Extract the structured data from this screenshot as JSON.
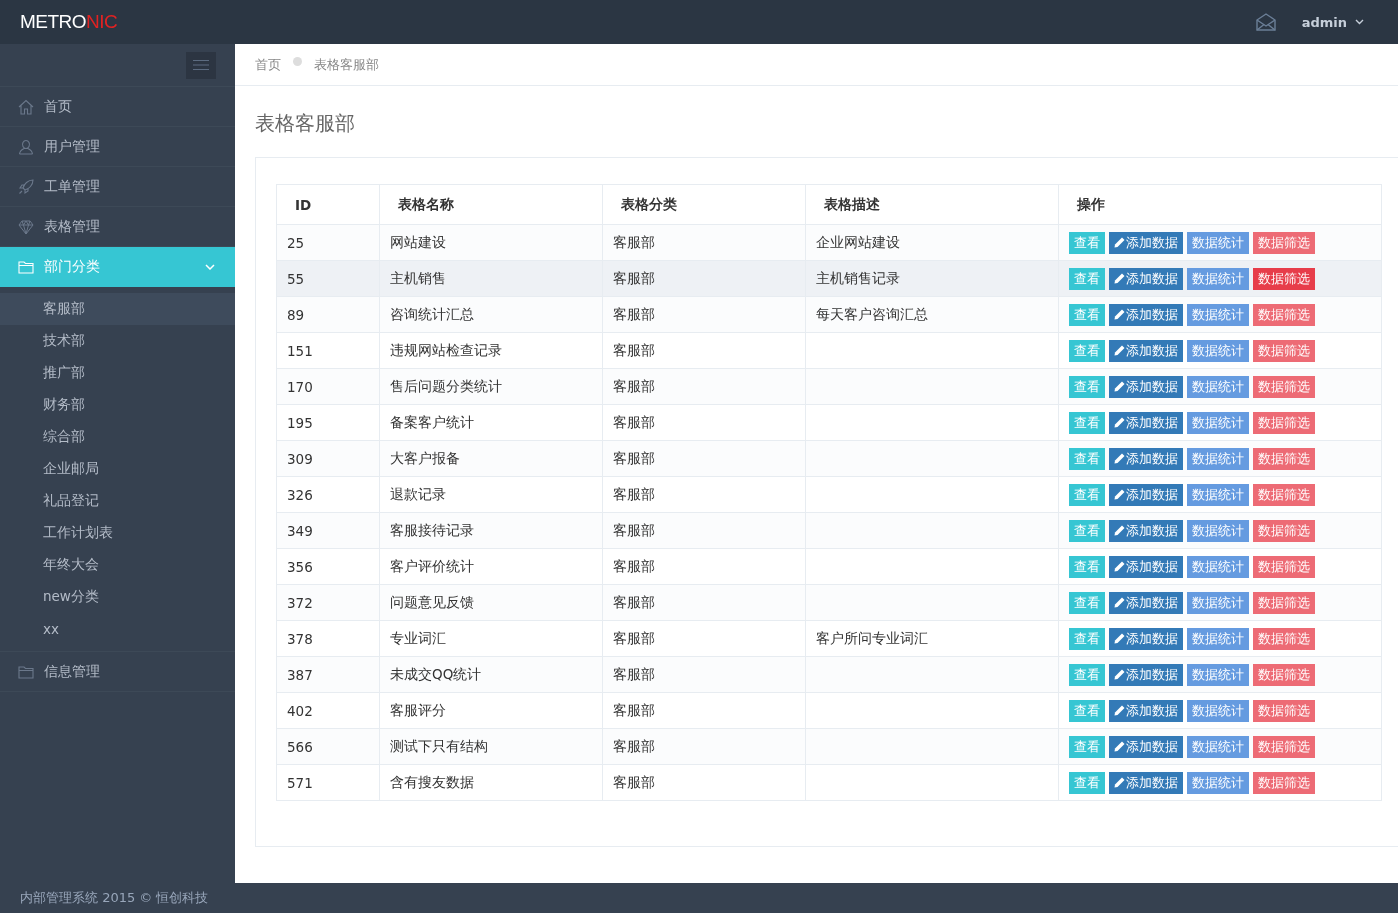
{
  "header": {
    "logo_part_1": "METRO",
    "logo_part_2": "NIC",
    "user": "admin"
  },
  "sidebar": {
    "items": [
      {
        "label": "首页",
        "selected": false
      },
      {
        "label": "用户管理",
        "selected": false
      },
      {
        "label": "工单管理",
        "selected": false
      },
      {
        "label": "表格管理",
        "selected": false
      },
      {
        "label": "部门分类",
        "selected": true,
        "expanded": true,
        "children": [
          {
            "label": "客服部",
            "selected": true
          },
          {
            "label": "技术部",
            "selected": false
          },
          {
            "label": "推广部",
            "selected": false
          },
          {
            "label": "财务部",
            "selected": false
          },
          {
            "label": "综合部",
            "selected": false
          },
          {
            "label": "企业邮局",
            "selected": false
          },
          {
            "label": "礼品登记",
            "selected": false
          },
          {
            "label": "工作计划表",
            "selected": false
          },
          {
            "label": "年终大会",
            "selected": false
          },
          {
            "label": "new分类",
            "selected": false
          },
          {
            "label": "xx",
            "selected": false
          }
        ]
      },
      {
        "label": "信息管理",
        "selected": false
      }
    ]
  },
  "breadcrumb": [
    "首页",
    "表格客服部"
  ],
  "page_title": "表格客服部",
  "table": {
    "columns": [
      "ID",
      "表格名称",
      "表格分类",
      "表格描述",
      "操作"
    ],
    "rows": [
      {
        "id": "25",
        "name": "网站建设",
        "category": "客服部",
        "description": "企业网站建设",
        "selected": false,
        "actions": [
          "查看",
          "添加数据",
          "数据统计",
          "数据筛选"
        ]
      },
      {
        "id": "55",
        "name": "主机销售",
        "category": "客服部",
        "description": "主机销售记录",
        "selected": true,
        "actions": [
          "查看",
          "添加数据",
          "数据统计",
          "数据筛选"
        ]
      },
      {
        "id": "89",
        "name": "咨询统计汇总",
        "category": "客服部",
        "description": "每天客户咨询汇总",
        "selected": false,
        "actions": [
          "查看",
          "添加数据",
          "数据统计",
          "数据筛选"
        ]
      },
      {
        "id": "151",
        "name": "违规网站检查记录",
        "category": "客服部",
        "selected": false,
        "actions": [
          "查看",
          "添加数据",
          "数据统计",
          "数据筛选"
        ]
      },
      {
        "id": "170",
        "name": "售后问题分类统计",
        "category": "客服部",
        "selected": false,
        "actions": [
          "查看",
          "添加数据",
          "数据统计",
          "数据筛选"
        ]
      },
      {
        "id": "195",
        "name": "备案客户统计",
        "category": "客服部",
        "selected": false,
        "actions": [
          "查看",
          "添加数据",
          "数据统计",
          "数据筛选"
        ]
      },
      {
        "id": "309",
        "name": "大客户报备",
        "category": "客服部",
        "selected": false,
        "actions": [
          "查看",
          "添加数据",
          "数据统计",
          "数据筛选"
        ]
      },
      {
        "id": "326",
        "name": "退款记录",
        "category": "客服部",
        "selected": false,
        "actions": [
          "查看",
          "添加数据",
          "数据统计",
          "数据筛选"
        ]
      },
      {
        "id": "349",
        "name": "客服接待记录",
        "category": "客服部",
        "selected": false,
        "actions": [
          "查看",
          "添加数据",
          "数据统计",
          "数据筛选"
        ]
      },
      {
        "id": "356",
        "name": "客户评价统计",
        "category": "客服部",
        "selected": false,
        "actions": [
          "查看",
          "添加数据",
          "数据统计",
          "数据筛选"
        ]
      },
      {
        "id": "372",
        "name": "问题意见反馈",
        "category": "客服部",
        "selected": false,
        "actions": [
          "查看",
          "添加数据",
          "数据统计",
          "数据筛选"
        ]
      },
      {
        "id": "378",
        "name": "专业词汇",
        "category": "客服部",
        "description": "客户所问专业词汇",
        "selected": false,
        "actions": [
          "查看",
          "添加数据",
          "数据统计",
          "数据筛选"
        ]
      },
      {
        "id": "387",
        "name": "未成交QQ统计",
        "category": "客服部",
        "selected": false,
        "actions": [
          "查看",
          "添加数据",
          "数据统计",
          "数据筛选"
        ]
      },
      {
        "id": "402",
        "name": "客服评分",
        "category": "客服部",
        "selected": false,
        "actions": [
          "查看",
          "添加数据",
          "数据统计",
          "数据筛选"
        ]
      },
      {
        "id": "566",
        "name": "测试下只有结构",
        "category": "客服部",
        "selected": false,
        "actions": [
          "查看",
          "添加数据",
          "数据统计",
          "数据筛选"
        ]
      },
      {
        "id": "571",
        "name": "含有搜友数据",
        "category": "客服部",
        "selected": false,
        "actions": [
          "查看",
          "添加数据",
          "数据统计",
          "数据筛选"
        ]
      }
    ]
  },
  "footer": "内部管理系统 2015 © 恒创科技"
}
